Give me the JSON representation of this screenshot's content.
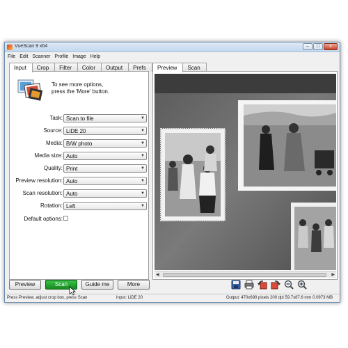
{
  "window": {
    "title": "VueScan 9 x64"
  },
  "title_buttons": {
    "minimize": "–",
    "maximize": "□",
    "close": "x"
  },
  "menu": [
    "File",
    "Edit",
    "Scanner",
    "Profile",
    "Image",
    "Help"
  ],
  "left_tabs": [
    "Input",
    "Crop",
    "Filter",
    "Color",
    "Output",
    "Prefs"
  ],
  "hint": {
    "line1": "To see more options,",
    "line2": "press the 'More' button."
  },
  "fields": [
    {
      "label": "Task:",
      "value": "Scan to file"
    },
    {
      "label": "Source:",
      "value": "LiDE 20"
    },
    {
      "label": "Media:",
      "value": "B/W photo"
    },
    {
      "label": "Media size:",
      "value": "Auto"
    },
    {
      "label": "Quality:",
      "value": "Print"
    },
    {
      "label": "Preview resolution:",
      "value": "Auto"
    },
    {
      "label": "Scan resolution:",
      "value": "Auto"
    },
    {
      "label": "Rotation:",
      "value": "Left"
    }
  ],
  "default_options": {
    "label": "Default options:",
    "checked": false
  },
  "right_tabs": [
    "Preview",
    "Scan"
  ],
  "buttons": {
    "preview": "Preview",
    "scan": "Scan",
    "guide": "Guide me",
    "more": "More"
  },
  "toolbar_icons": [
    "save-icon",
    "print-icon",
    "rotate-left-icon",
    "rotate-right-icon",
    "zoom-out-icon",
    "zoom-in-icon"
  ],
  "status": {
    "left": "Press Preview, adjust crop box, press Scan",
    "middle": "Input: LiDE 20",
    "right": "Output: 470x690 pixels 200 dpi 59.7x87.6 mm 0.0973 MB"
  },
  "colors": {
    "scan_button": "#16891f",
    "window_border": "#6d8fb3",
    "preview_bg": "#6b6b6b"
  }
}
